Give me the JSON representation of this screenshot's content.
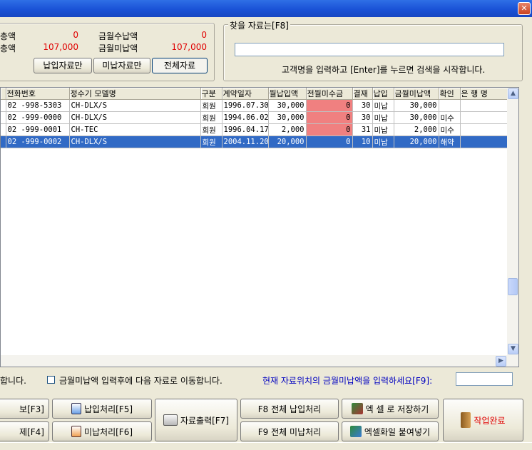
{
  "window": {
    "close_glyph": "✕"
  },
  "summary": {
    "total_paid_label": "총액",
    "total_paid_value": "0",
    "total_unpaid_label": "총액",
    "total_unpaid_value": "107,000",
    "month_paid_label": "금월수납액",
    "month_paid_value": "0",
    "month_unpaid_label": "금월미납액",
    "month_unpaid_value": "107,000",
    "filter_paid": "납입자료만",
    "filter_unpaid": "미납자료만",
    "filter_all": "전체자료"
  },
  "search": {
    "legend": "찾을 자료는[F8]",
    "value": "",
    "hint": "고객명을 입력하고 [Enter]를 누르면 검색을 시작합니다."
  },
  "grid": {
    "columns": [
      "전화번호",
      "정수기 모델명",
      "구분",
      "계약일자",
      "월납입액",
      "전월미수금",
      "결재",
      "납입",
      "금월미납액",
      "확인",
      "은 행 명"
    ],
    "rows": [
      [
        "02  -998-5303",
        "CH-DLX/S",
        "회원",
        "1996.07.30",
        "30,000",
        "0",
        "30",
        "미납",
        "30,000",
        "",
        ""
      ],
      [
        "02  -999-0000",
        "CH-DLX/S",
        "회원",
        "1994.06.02",
        "30,000",
        "0",
        "30",
        "미납",
        "30,000",
        "미수",
        ""
      ],
      [
        "02  -999-0001",
        "CH-TEC",
        "회원",
        "1996.04.17",
        "2,000",
        "0",
        "31",
        "미납",
        "2,000",
        "미수",
        ""
      ],
      [
        "02  -999-0002",
        "CH-DLX/S",
        "회원",
        "2004.11.20",
        "20,000",
        "0",
        "10",
        "미납",
        "20,000",
        "해약",
        ""
      ]
    ],
    "selected_row": 3
  },
  "scroll": {
    "up": "▲",
    "down": "▼",
    "right": "▶"
  },
  "options": {
    "prefix_text": "합니다.",
    "auto_move_label": "금월미납액 입력후에 다음 자료로 이동합니다.",
    "auto_move_checked": false,
    "unpaid_prompt": "현재 자료위치의 금월미납액을 입력하세요[F9]:",
    "unpaid_value": ""
  },
  "buttons": {
    "info": "보[F3]",
    "delete": "제[F4]",
    "pay": "납입처리[F5]",
    "unpay": "미납처리[F6]",
    "print": "자료출력[F7]",
    "all_pay": "F8 전체 납입처리",
    "all_unpay": "F9 전체 미납처리",
    "excel_save": "엑 셀 로 저장하기",
    "excel_paste": "엑셀화일 붙여넣기",
    "done": "작업완료"
  },
  "colors": {
    "accent": "#316ac5",
    "alert": "#e00000",
    "highlight": "#f08080"
  },
  "icons": [
    "close-icon",
    "pay-icon",
    "unpay-icon",
    "print-icon",
    "excel-icon",
    "exit-door-icon"
  ]
}
